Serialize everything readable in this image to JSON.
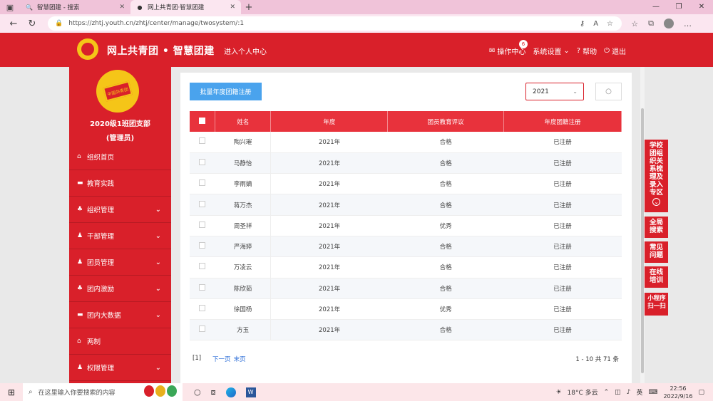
{
  "browser": {
    "tabs": [
      {
        "title": "智慧团建 - 搜索",
        "favicon": "search-icon"
      },
      {
        "title": "网上共青团·智慧团建",
        "favicon": "league-icon"
      }
    ],
    "url": "https://zhtj.youth.cn/zhtj/center/manage/twosystem/:1"
  },
  "header": {
    "title": "网上共青团 • 智慧团建",
    "personal_center": "进入个人中心",
    "op_center": "操作中心",
    "op_badge": "6",
    "settings": "系统设置",
    "help": "帮助",
    "logout": "退出"
  },
  "sidebar": {
    "org_name": "2020级1班团支部",
    "role": "(管理员)",
    "emblem_text": "中国共青团",
    "items": [
      {
        "label": "组织首页",
        "icon": "home-icon",
        "expandable": false
      },
      {
        "label": "教育实践",
        "icon": "folder-icon",
        "expandable": false
      },
      {
        "label": "组织管理",
        "icon": "org-icon",
        "expandable": true
      },
      {
        "label": "干部管理",
        "icon": "users-icon",
        "expandable": true
      },
      {
        "label": "团员管理",
        "icon": "users-icon",
        "expandable": true
      },
      {
        "label": "团内激励",
        "icon": "org-icon",
        "expandable": true
      },
      {
        "label": "团内大数据",
        "icon": "folder-icon",
        "expandable": true
      },
      {
        "label": "两制",
        "icon": "home-icon",
        "expandable": false
      },
      {
        "label": "权限管理",
        "icon": "users-icon",
        "expandable": true
      }
    ]
  },
  "toolbar": {
    "batch_button": "批量年度团籍注册",
    "year_value": "2021"
  },
  "table": {
    "headers": [
      "姓名",
      "年度",
      "团员教育评议",
      "年度团籍注册"
    ],
    "rows": [
      [
        "陶兴璀",
        "2021年",
        "合格",
        "已注册"
      ],
      [
        "马静怡",
        "2021年",
        "合格",
        "已注册"
      ],
      [
        "李雨嫡",
        "2021年",
        "合格",
        "已注册"
      ],
      [
        "蒋万杰",
        "2021年",
        "合格",
        "已注册"
      ],
      [
        "周圣祥",
        "2021年",
        "优秀",
        "已注册"
      ],
      [
        "严海婷",
        "2021年",
        "合格",
        "已注册"
      ],
      [
        "万凌云",
        "2021年",
        "合格",
        "已注册"
      ],
      [
        "陈欣茹",
        "2021年",
        "合格",
        "已注册"
      ],
      [
        "徐国杨",
        "2021年",
        "优秀",
        "已注册"
      ],
      [
        "方玉",
        "2021年",
        "合格",
        "已注册"
      ]
    ]
  },
  "pager": {
    "current": "[1]",
    "next": "下一页",
    "last": "末页",
    "total": "1 - 10 共 71 条"
  },
  "float_panel": {
    "zone": "学校团组织关系梳理及录入专区",
    "search": "全局搜索",
    "faq": "常见问题",
    "training": "在线培训",
    "miniapp": "小程序扫一扫"
  },
  "taskbar": {
    "search_placeholder": "在这里输入你要搜索的内容",
    "weather": "18°C 多云",
    "ime": "英",
    "time": "22:56",
    "date": "2022/9/16"
  },
  "colors": {
    "brand_red": "#d9202a",
    "table_header": "#e8323c",
    "button_blue": "#4aa3ed",
    "link_blue": "#2f6fd8"
  }
}
